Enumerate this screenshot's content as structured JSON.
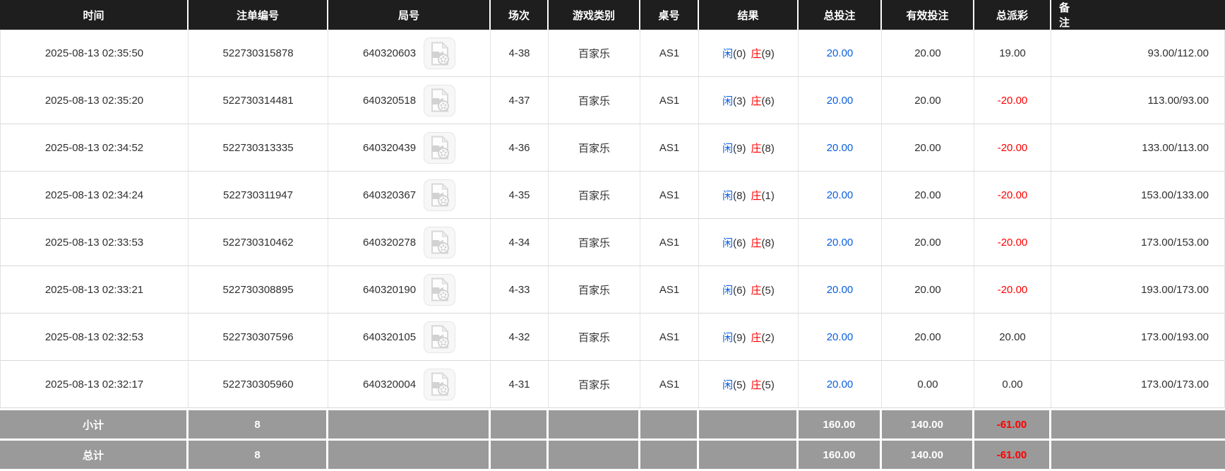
{
  "columns": [
    {
      "label": "时间"
    },
    {
      "label": "注单编号"
    },
    {
      "label": "局号"
    },
    {
      "label": "场次"
    },
    {
      "label": "游戏类别"
    },
    {
      "label": "桌号"
    },
    {
      "label": "结果"
    },
    {
      "label": "总投注"
    },
    {
      "label": "有效投注"
    },
    {
      "label": "总派彩"
    },
    {
      "label": "备注"
    }
  ],
  "rows": [
    {
      "time": "2025-08-13 02:35:50",
      "bet_id": "522730315878",
      "round_id": "640320603",
      "session": "4-38",
      "game": "百家乐",
      "table_no": "AS1",
      "player": "闲",
      "player_n": "(0)",
      "banker": "庄",
      "banker_n": "(9)",
      "total_bet": "20.00",
      "valid_bet": "20.00",
      "payout": "19.00",
      "remark": "93.00/112.00"
    },
    {
      "time": "2025-08-13 02:35:20",
      "bet_id": "522730314481",
      "round_id": "640320518",
      "session": "4-37",
      "game": "百家乐",
      "table_no": "AS1",
      "player": "闲",
      "player_n": "(3)",
      "banker": "庄",
      "banker_n": "(6)",
      "total_bet": "20.00",
      "valid_bet": "20.00",
      "payout": "-20.00",
      "remark": "113.00/93.00"
    },
    {
      "time": "2025-08-13 02:34:52",
      "bet_id": "522730313335",
      "round_id": "640320439",
      "session": "4-36",
      "game": "百家乐",
      "table_no": "AS1",
      "player": "闲",
      "player_n": "(9)",
      "banker": "庄",
      "banker_n": "(8)",
      "total_bet": "20.00",
      "valid_bet": "20.00",
      "payout": "-20.00",
      "remark": "133.00/113.00"
    },
    {
      "time": "2025-08-13 02:34:24",
      "bet_id": "522730311947",
      "round_id": "640320367",
      "session": "4-35",
      "game": "百家乐",
      "table_no": "AS1",
      "player": "闲",
      "player_n": "(8)",
      "banker": "庄",
      "banker_n": "(1)",
      "total_bet": "20.00",
      "valid_bet": "20.00",
      "payout": "-20.00",
      "remark": "153.00/133.00"
    },
    {
      "time": "2025-08-13 02:33:53",
      "bet_id": "522730310462",
      "round_id": "640320278",
      "session": "4-34",
      "game": "百家乐",
      "table_no": "AS1",
      "player": "闲",
      "player_n": "(6)",
      "banker": "庄",
      "banker_n": "(8)",
      "total_bet": "20.00",
      "valid_bet": "20.00",
      "payout": "-20.00",
      "remark": "173.00/153.00"
    },
    {
      "time": "2025-08-13 02:33:21",
      "bet_id": "522730308895",
      "round_id": "640320190",
      "session": "4-33",
      "game": "百家乐",
      "table_no": "AS1",
      "player": "闲",
      "player_n": "(6)",
      "banker": "庄",
      "banker_n": "(5)",
      "total_bet": "20.00",
      "valid_bet": "20.00",
      "payout": "-20.00",
      "remark": "193.00/173.00"
    },
    {
      "time": "2025-08-13 02:32:53",
      "bet_id": "522730307596",
      "round_id": "640320105",
      "session": "4-32",
      "game": "百家乐",
      "table_no": "AS1",
      "player": "闲",
      "player_n": "(9)",
      "banker": "庄",
      "banker_n": "(2)",
      "total_bet": "20.00",
      "valid_bet": "20.00",
      "payout": "20.00",
      "remark": "173.00/193.00"
    },
    {
      "time": "2025-08-13 02:32:17",
      "bet_id": "522730305960",
      "round_id": "640320004",
      "session": "4-31",
      "game": "百家乐",
      "table_no": "AS1",
      "player": "闲",
      "player_n": "(5)",
      "banker": "庄",
      "banker_n": "(5)",
      "total_bet": "20.00",
      "valid_bet": "0.00",
      "payout": "0.00",
      "remark": "173.00/173.00"
    }
  ],
  "subtotal": {
    "label": "小计",
    "count": "8",
    "total_bet": "160.00",
    "valid_bet": "140.00",
    "total_payout": "-61.00"
  },
  "grand_total": {
    "label": "总计",
    "count": "8",
    "total_bet": "160.00",
    "valid_bet": "140.00",
    "total_payout": "-61.00"
  },
  "icons": {
    "round_video": "video-file-icon"
  },
  "colors": {
    "header_bg": "#1e1e1e",
    "footer_bg": "#9a9a9a",
    "player_blue": "#0b5fdd",
    "banker_red": "#ff0000",
    "total_bet_blue": "#0b5fdd",
    "negative_red": "#ff0000"
  }
}
